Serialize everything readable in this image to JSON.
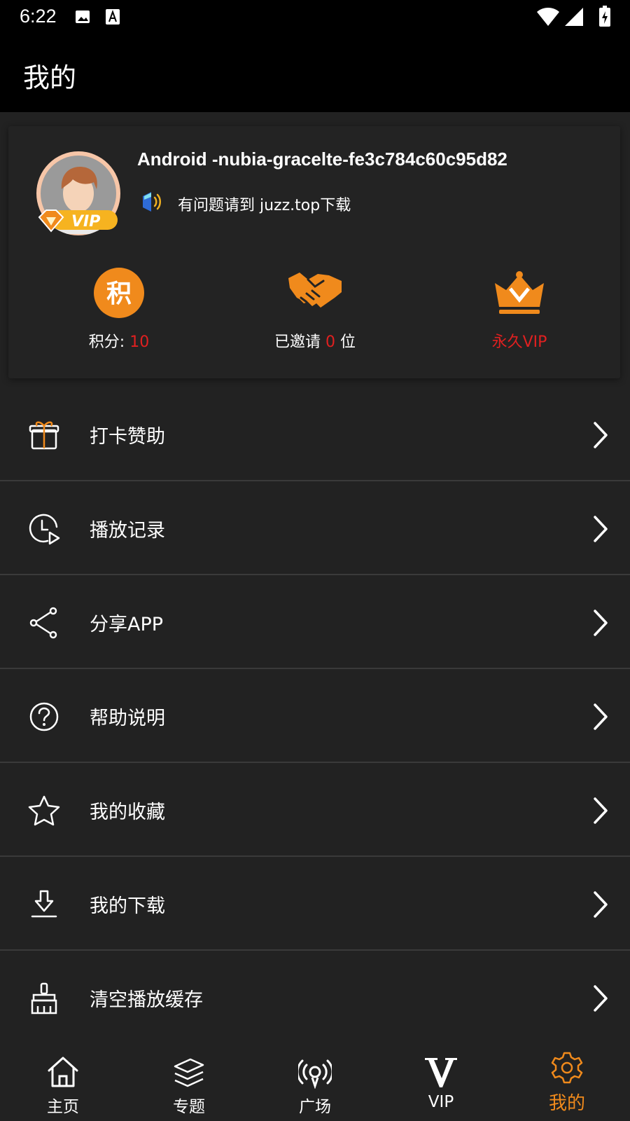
{
  "status_bar": {
    "time": "6:22"
  },
  "app_bar": {
    "title": "我的"
  },
  "profile": {
    "username": "Android -nubia-gracelte-fe3c784c60c95d82",
    "badge": "VIP",
    "notice": "有问题请到 juzz.top下载"
  },
  "stats": {
    "points": {
      "icon_text": "积",
      "label": "积分:",
      "value": "10"
    },
    "invited": {
      "prefix": "已邀请 ",
      "value": "0",
      "suffix": " 位"
    },
    "vip": {
      "label": "永久VIP"
    }
  },
  "menu": [
    {
      "label": "打卡赞助",
      "icon": "gift-icon"
    },
    {
      "label": "播放记录",
      "icon": "history-icon"
    },
    {
      "label": "分享APP",
      "icon": "share-icon"
    },
    {
      "label": "帮助说明",
      "icon": "help-icon"
    },
    {
      "label": "我的收藏",
      "icon": "star-icon"
    },
    {
      "label": "我的下载",
      "icon": "download-icon"
    },
    {
      "label": "清空播放缓存",
      "icon": "broom-icon"
    }
  ],
  "tabs": [
    {
      "label": "主页",
      "icon": "home-icon"
    },
    {
      "label": "专题",
      "icon": "layers-icon"
    },
    {
      "label": "广场",
      "icon": "broadcast-icon"
    },
    {
      "label": "VIP",
      "icon": "vip-v-icon"
    },
    {
      "label": "我的",
      "icon": "gear-icon",
      "active": true
    }
  ],
  "colors": {
    "accent": "#f08a1c",
    "highlight_red": "#e02020",
    "background": "#222222"
  }
}
